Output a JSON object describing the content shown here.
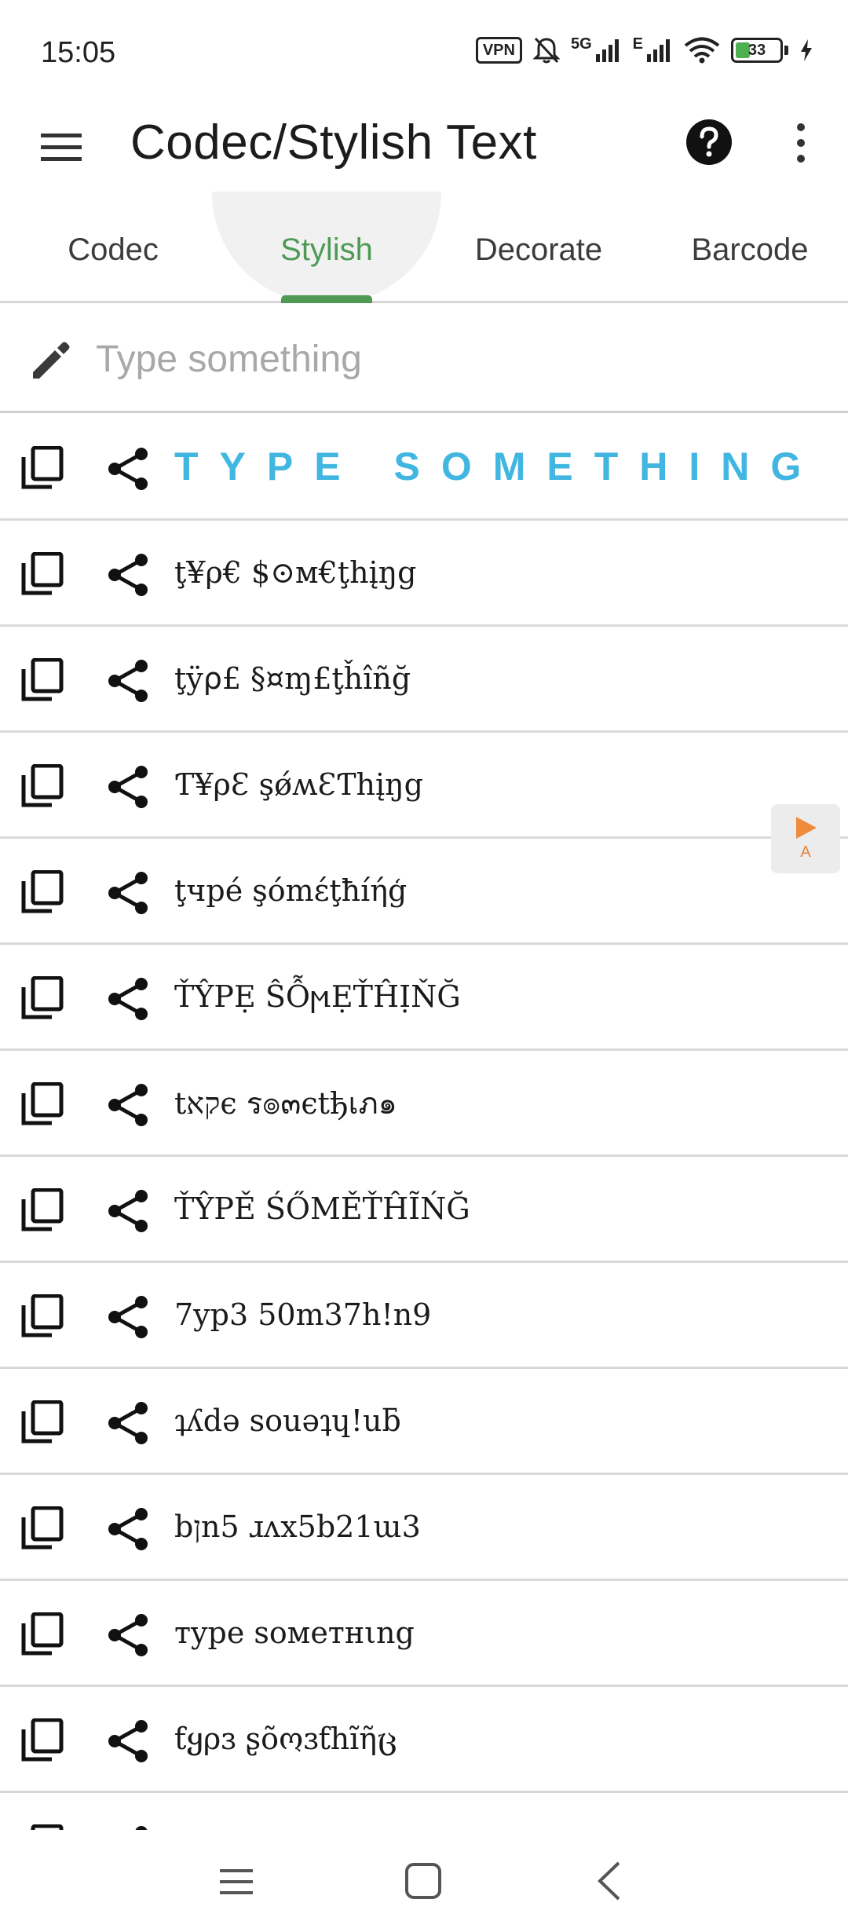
{
  "status_bar": {
    "time": "15:05",
    "vpn": "VPN",
    "network_1": "5G",
    "network_2": "E",
    "battery": "33",
    "battery_level_percent": 33
  },
  "app_bar": {
    "title": "Codec/Stylish Text",
    "menu_icon": "hamburger-menu-icon",
    "help_icon": "help-circle-icon",
    "more_icon": "more-vertical-icon"
  },
  "tabs": [
    {
      "label": "Codec",
      "active": false
    },
    {
      "label": "Stylish",
      "active": true
    },
    {
      "label": "Decorate",
      "active": false
    },
    {
      "label": "Barcode",
      "active": false
    }
  ],
  "input": {
    "placeholder": "Type something",
    "value": "",
    "icon": "pencil-icon"
  },
  "styled_items": [
    {
      "text": "TYPE SOMETHING"
    },
    {
      "text": "ţ¥ρ€ $⊙м€ţhįŋg"
    },
    {
      "text": "ţÿ⍴£ §¤ɱ£ţȟîñğ"
    },
    {
      "text": "Ƭ¥ρƐ şǿʍƐƬhįŋg"
    },
    {
      "text": "ţчpé şómέţħíήģ"
    },
    {
      "text": "ŤŶPẸ ŜỖϻẸŤĤỊŇĞ"
    },
    {
      "text": "tקאє ร๏๓єtђเภ๑"
    },
    {
      "text": "ŤŶPĚ ŚŐMĚŤĤĨŃĞ"
    },
    {
      "text": "7yp3 50m37h!n9"
    },
    {
      "text": "ʇʎdə souəʇɥ!uƃ"
    },
    {
      "text": "bןn5 ɹʌx5b21ɯ3"
    },
    {
      "text": "тype ѕoмeтнιng"
    },
    {
      "text": "ƭყρɜ ʂõოɜƭհĩῆც"
    }
  ],
  "float_ad": {
    "label": "A",
    "accent": "#f08a3c"
  },
  "colors": {
    "accent_green": "#4e9a55",
    "fancy_blue": "#41b6e0"
  },
  "nav_bar": {
    "icons": [
      "recents-icon",
      "home-icon",
      "back-icon"
    ]
  }
}
